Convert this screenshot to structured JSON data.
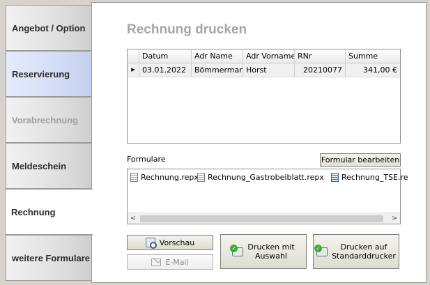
{
  "tabs": [
    {
      "label": "Angebot / Option"
    },
    {
      "label": "Reservierung"
    },
    {
      "label": "Vorabrechnung"
    },
    {
      "label": "Meldeschein"
    },
    {
      "label": "Rechnung"
    },
    {
      "label": "weitere Formulare"
    }
  ],
  "page": {
    "title": "Rechnung drucken"
  },
  "grid": {
    "columns": [
      "Datum",
      "Adr Name",
      "Adr Vorname",
      "RNr",
      "Summe"
    ],
    "rows": [
      {
        "datum": "03.01.2022",
        "name": "Bömmermann",
        "vorname": "Horst",
        "rnr": "20210077",
        "summe": "341,00 €"
      }
    ]
  },
  "formulare": {
    "label": "Formulare",
    "edit_button": "Formular bearbeiten",
    "files": [
      "Rechnung.repx",
      "Rechnung_Gastrobeiblatt.repx",
      "Rechnung_TSE.re"
    ]
  },
  "buttons": {
    "vorschau": "Vorschau",
    "email": "E-Mail",
    "drucken_auswahl_line1": "Drucken mit",
    "drucken_auswahl_line2": "Auswahl",
    "drucken_std_line1": "Drucken auf",
    "drucken_std_line2": "Standarddrucker"
  }
}
